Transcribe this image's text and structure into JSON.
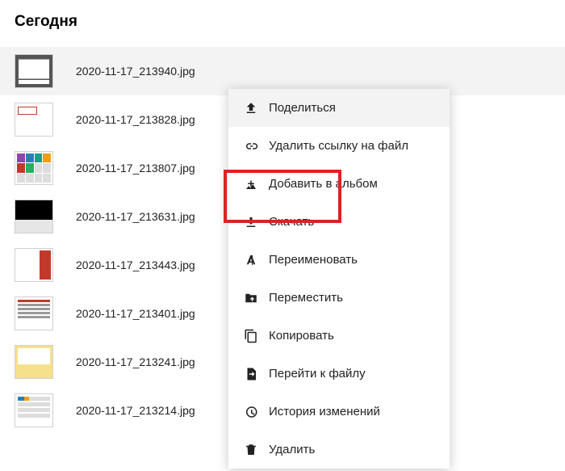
{
  "header": {
    "title": "Сегодня"
  },
  "files": [
    {
      "name": "2020-11-17_213940.jpg"
    },
    {
      "name": "2020-11-17_213828.jpg"
    },
    {
      "name": "2020-11-17_213807.jpg"
    },
    {
      "name": "2020-11-17_213631.jpg"
    },
    {
      "name": "2020-11-17_213443.jpg"
    },
    {
      "name": "2020-11-17_213401.jpg"
    },
    {
      "name": "2020-11-17_213241.jpg"
    },
    {
      "name": "2020-11-17_213214.jpg"
    }
  ],
  "menu": {
    "share": "Поделиться",
    "remove_link": "Удалить ссылку на файл",
    "add_album": "Добавить в альбом",
    "download": "Скачать",
    "rename": "Переименовать",
    "move": "Переместить",
    "copy": "Копировать",
    "goto_file": "Перейти к файлу",
    "history": "История изменений",
    "delete": "Удалить"
  }
}
